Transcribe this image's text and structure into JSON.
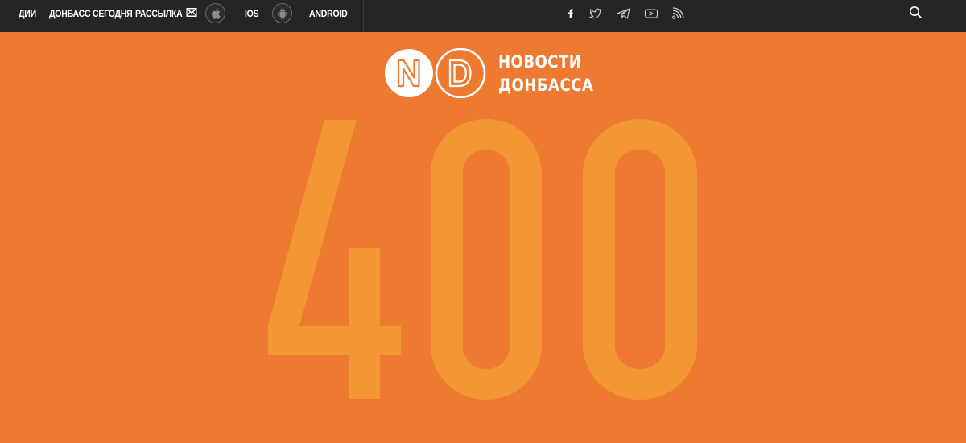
{
  "nav": {
    "items": [
      {
        "label": "ДИИ"
      },
      {
        "label": "ДОНБАСС СЕГОДНЯ"
      },
      {
        "label": "РАССЫЛКА"
      },
      {
        "label": "IOS"
      },
      {
        "label": "ANDROID"
      }
    ],
    "icons": [
      "mail-icon",
      "apple-icon",
      "android-icon"
    ]
  },
  "social": [
    "facebook-icon",
    "twitter-icon",
    "telegram-icon",
    "youtube-icon",
    "rss-icon"
  ],
  "search": {
    "icon": "search-icon"
  },
  "logo": {
    "mark_letters": [
      "N",
      "D"
    ],
    "line1": "НОВОСТИ",
    "line2": "ДОНБАССА"
  },
  "error": {
    "code": "400"
  },
  "colors": {
    "topbar": "#252525",
    "background": "#ee7a32",
    "code_digits": "#f29733",
    "text": "#ffffff"
  }
}
